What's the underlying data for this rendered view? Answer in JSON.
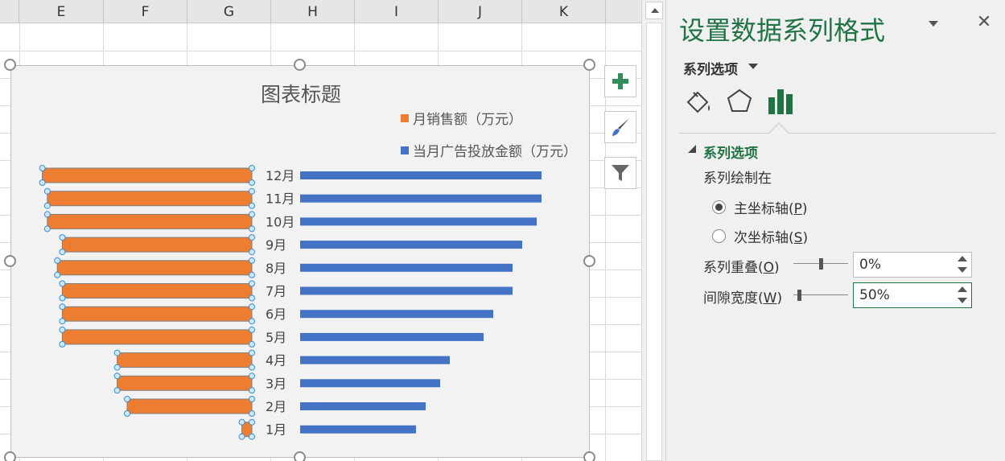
{
  "sheet": {
    "columns": [
      "E",
      "F",
      "G",
      "H",
      "I",
      "J",
      "K"
    ]
  },
  "chart_data": {
    "type": "bar",
    "title": "图表标题",
    "categories": [
      "12月",
      "11月",
      "10月",
      "9月",
      "8月",
      "7月",
      "6月",
      "5月",
      "4月",
      "3月",
      "2月",
      "1月"
    ],
    "series": [
      {
        "name": "月销售额（万元）",
        "color": "#ed7d31",
        "values": [
          42,
          41,
          41,
          38,
          39,
          38,
          38,
          38,
          27,
          27,
          25,
          2
        ]
      },
      {
        "name": "当月广告投放金额（万元）",
        "color": "#4472c4",
        "values": [
          50,
          50,
          49,
          46,
          44,
          44,
          40,
          38,
          31,
          29,
          26,
          24
        ]
      }
    ],
    "orange_direction": "left",
    "blue_direction": "right",
    "legend_position": "top-right",
    "grid": false
  },
  "side_buttons": [
    "plus-icon",
    "brush-icon",
    "filter-icon"
  ],
  "pane": {
    "title": "设置数据系列格式",
    "close_glyph": "✕",
    "options_menu": "系列选项",
    "section": {
      "title": "系列选项",
      "plot_on_label": "系列绘制在",
      "primary_axis": {
        "label": "主坐标轴(",
        "key": "P",
        "suffix": ")",
        "checked": true
      },
      "secondary_axis": {
        "label": "次坐标轴(",
        "key": "S",
        "suffix": ")",
        "checked": false
      },
      "overlap": {
        "label": "系列重叠(",
        "key": "O",
        "suffix": ")",
        "value": "0%",
        "level": 0.5
      },
      "gap_width": {
        "label": "间隙宽度(",
        "key": "W",
        "suffix": ")",
        "value": "50%",
        "level": 0.1
      }
    },
    "accent_color": "#217346"
  }
}
